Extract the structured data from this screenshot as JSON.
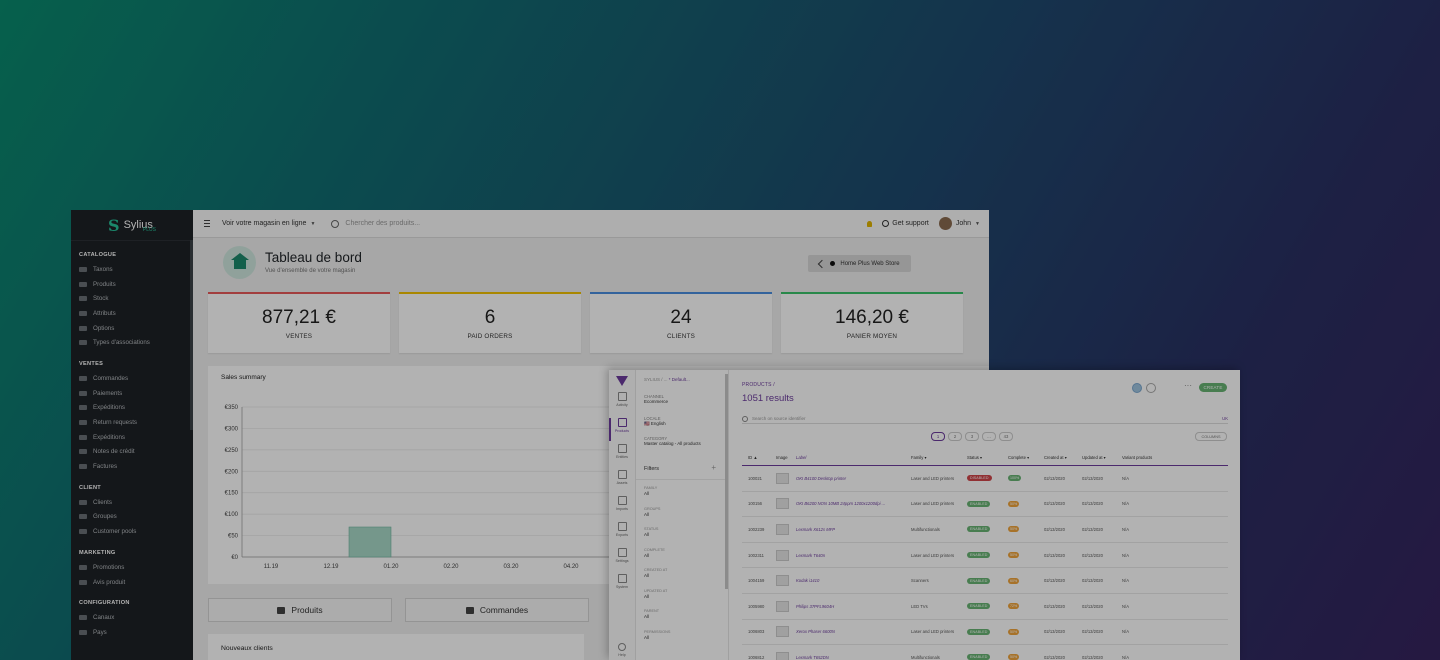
{
  "sylius": {
    "logo_text": "Sylius",
    "logo_sub": "PLUS",
    "sidebar": {
      "sections": [
        {
          "title": "CATALOGUE",
          "items": [
            "Taxons",
            "Produits",
            "Stock",
            "Attributs",
            "Options",
            "Types d'associations"
          ]
        },
        {
          "title": "VENTES",
          "items": [
            "Commandes",
            "Paiements",
            "Expéditions",
            "Return requests",
            "Expéditions",
            "Notes de crédit",
            "Factures"
          ]
        },
        {
          "title": "CLIENT",
          "items": [
            "Clients",
            "Groupes",
            "Customer pools"
          ]
        },
        {
          "title": "MARKETING",
          "items": [
            "Promotions",
            "Avis produit"
          ]
        },
        {
          "title": "CONFIGURATION",
          "items": [
            "Canaux",
            "Pays"
          ]
        }
      ]
    },
    "topbar": {
      "store_link": "Voir votre magasin en ligne",
      "search_placeholder": "Chercher des produits...",
      "support": "Get support",
      "user": "John"
    },
    "header": {
      "title": "Tableau de bord",
      "subtitle": "Vue d'ensemble de votre magasin",
      "store_button": "Home Plus Web Store"
    },
    "stats": [
      {
        "value": "877,21 €",
        "label": "VENTES",
        "color": "#e85a5a"
      },
      {
        "value": "6",
        "label": "PAID ORDERS",
        "color": "#f2c200"
      },
      {
        "value": "24",
        "label": "CLIENTS",
        "color": "#4a8ee0"
      },
      {
        "value": "146,20 €",
        "label": "PANIER MOYEN",
        "color": "#3cc36a"
      }
    ],
    "sales_title": "Sales summary",
    "tabs": [
      {
        "label": "Produits",
        "icon": "cubes-icon"
      },
      {
        "label": "Commandes",
        "icon": "cart-icon"
      }
    ],
    "new_clients": "Nouveaux clients"
  },
  "chart_data": {
    "type": "bar",
    "title": "Sales summary",
    "categories": [
      "11.19",
      "12.19",
      "01.20",
      "02.20",
      "03.20",
      "04.20"
    ],
    "values": [
      0,
      70,
      0,
      0,
      0,
      0
    ],
    "ylim": [
      0,
      350
    ],
    "yticks": [
      "€0",
      "€50",
      "€100",
      "€150",
      "€200",
      "€250",
      "€300",
      "€350"
    ],
    "bar_color": "#a8d8c8",
    "grid": true
  },
  "akeneo": {
    "breadcrumb_prefix": "SYLIUS / ...",
    "breadcrumb_view": "* Default...",
    "context": [
      {
        "label": "CHANNEL",
        "value": "Ecommerce"
      },
      {
        "label": "LOCALE",
        "value": "🇺🇸 English"
      },
      {
        "label": "CATEGORY",
        "value": "Master catalog - All products"
      }
    ],
    "nav": [
      {
        "label": "Activity",
        "icon": "activity-icon"
      },
      {
        "label": "Products",
        "icon": "products-icon",
        "active": true
      },
      {
        "label": "Entities",
        "icon": "entities-icon"
      },
      {
        "label": "Assets",
        "icon": "assets-icon"
      },
      {
        "label": "Imports",
        "icon": "imports-icon"
      },
      {
        "label": "Exports",
        "icon": "exports-icon"
      },
      {
        "label": "Settings",
        "icon": "settings-icon"
      },
      {
        "label": "System",
        "icon": "system-icon"
      }
    ],
    "help": "Help",
    "filters_title": "Filters",
    "filters": [
      {
        "label": "FAMILY",
        "value": "All"
      },
      {
        "label": "GROUPS",
        "value": "All"
      },
      {
        "label": "STATUS",
        "value": "All"
      },
      {
        "label": "COMPLETE",
        "value": "All"
      },
      {
        "label": "CREATED AT",
        "value": "All"
      },
      {
        "label": "UPDATED AT",
        "value": "All"
      },
      {
        "label": "PARENT",
        "value": "All"
      },
      {
        "label": "PERMISSIONS",
        "value": "All"
      }
    ],
    "crumb": "PRODUCTS /",
    "results": "1051 results",
    "create": "CREATE",
    "search_placeholder": "Search on source identifier",
    "locale_short": "UK",
    "pages": [
      "1",
      "2",
      "3",
      "...",
      "43"
    ],
    "columns_btn": "COLUMNS",
    "headers": [
      "ID ▲",
      "Image",
      "Label",
      "Family ▾",
      "Status ▾",
      "Complete ▾",
      "Created at ▾",
      "Updated at ▾",
      "Variant products"
    ],
    "rows": [
      {
        "id": "100021",
        "label": "OKI B4100 Desktop printer",
        "family": "Laser and LED printers",
        "status": "DISABLED",
        "complete": "100%",
        "created": "02/13/2020",
        "updated": "02/13/2020",
        "variant": "N/A"
      },
      {
        "id": "100156",
        "label": "OKI B6200 NON 10MB 24ppm 1200x1200dpi ...",
        "family": "Laser and LED printers",
        "status": "ENABLED",
        "complete": "50%",
        "created": "02/13/2020",
        "updated": "02/13/2020",
        "variant": "N/A"
      },
      {
        "id": "1002239",
        "label": "Lexmark X612s MFP",
        "family": "Multifunctionals",
        "status": "ENABLED",
        "complete": "50%",
        "created": "02/13/2020",
        "updated": "02/13/2020",
        "variant": "N/A"
      },
      {
        "id": "1002311",
        "label": "Lexmark T640n",
        "family": "Laser and LED printers",
        "status": "ENABLED",
        "complete": "50%",
        "created": "02/13/2020",
        "updated": "02/13/2020",
        "variant": "N/A"
      },
      {
        "id": "1004159",
        "label": "Kodak i1410",
        "family": "Scanners",
        "status": "ENABLED",
        "complete": "60%",
        "created": "02/13/2020",
        "updated": "02/13/2020",
        "variant": "N/A"
      },
      {
        "id": "1005980",
        "label": "Philips 37PFL9604H",
        "family": "LED TVs",
        "status": "ENABLED",
        "complete": "72%",
        "created": "02/13/2020",
        "updated": "02/13/2020",
        "variant": "N/A"
      },
      {
        "id": "1006803",
        "label": "Xerox Phaser 6600N",
        "family": "Laser and LED printers",
        "status": "ENABLED",
        "complete": "50%",
        "created": "02/13/2020",
        "updated": "02/13/2020",
        "variant": "N/A"
      },
      {
        "id": "1006812",
        "label": "Lexmark T652DN",
        "family": "Multifunctionals",
        "status": "ENABLED",
        "complete": "50%",
        "created": "02/13/2020",
        "updated": "02/13/2020",
        "variant": "N/A"
      }
    ]
  }
}
